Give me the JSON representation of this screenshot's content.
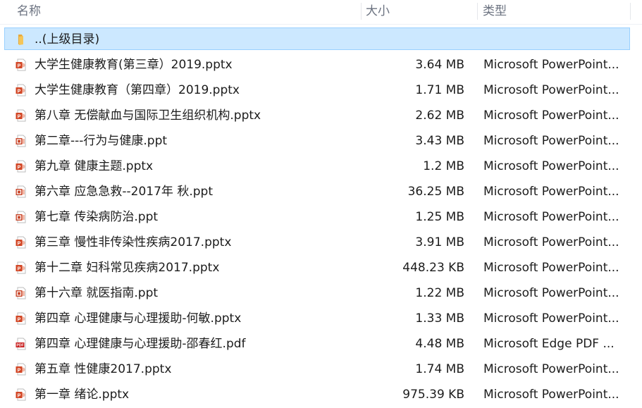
{
  "columns": {
    "name": "名称",
    "size": "大小",
    "type": "类型"
  },
  "colors": {
    "selected_background": "#cce8ff",
    "selected_border": "#99d1ff",
    "ppt_icon": "#d24726",
    "pdf_icon": "#c81e1e",
    "folder_icon": "#f4c55a"
  },
  "parent_row": {
    "name": "..(上级目录)",
    "icon": "folder-icon",
    "selected": true
  },
  "files": [
    {
      "name": "大学生健康教育(第三章）2019.pptx",
      "size": "3.64 MB",
      "type": "Microsoft PowerPoint...",
      "icon": "pptx-file-icon"
    },
    {
      "name": "大学生健康教育（第四章）2019.pptx",
      "size": "1.71 MB",
      "type": "Microsoft PowerPoint...",
      "icon": "pptx-file-icon"
    },
    {
      "name": "第八章  无偿献血与国际卫生组织机构.pptx",
      "size": "2.62 MB",
      "type": "Microsoft PowerPoint...",
      "icon": "pptx-file-icon"
    },
    {
      "name": "第二章---行为与健康.ppt",
      "size": "3.43 MB",
      "type": "Microsoft PowerPoint...",
      "icon": "ppt-file-icon"
    },
    {
      "name": "第九章  健康主题.pptx",
      "size": "1.2 MB",
      "type": "Microsoft PowerPoint...",
      "icon": "pptx-file-icon"
    },
    {
      "name": "第六章 应急急救--2017年 秋.ppt",
      "size": "36.25 MB",
      "type": "Microsoft PowerPoint...",
      "icon": "ppt-file-icon"
    },
    {
      "name": "第七章 传染病防治.ppt",
      "size": "1.25 MB",
      "type": "Microsoft PowerPoint...",
      "icon": "ppt-file-icon"
    },
    {
      "name": "第三章  慢性非传染性疾病2017.pptx",
      "size": "3.91 MB",
      "type": "Microsoft PowerPoint...",
      "icon": "pptx-file-icon"
    },
    {
      "name": "第十二章  妇科常见疾病2017.pptx",
      "size": "448.23 KB",
      "type": "Microsoft PowerPoint...",
      "icon": "pptx-file-icon"
    },
    {
      "name": "第十六章 就医指南.ppt",
      "size": "1.22 MB",
      "type": "Microsoft PowerPoint...",
      "icon": "ppt-file-icon"
    },
    {
      "name": "第四章  心理健康与心理援助-何敏.pptx",
      "size": "1.33 MB",
      "type": "Microsoft PowerPoint...",
      "icon": "pptx-file-icon"
    },
    {
      "name": "第四章 心理健康与心理援助-邵春红.pdf",
      "size": "4.48 MB",
      "type": "Microsoft Edge PDF ...",
      "icon": "pdf-file-icon"
    },
    {
      "name": "第五章 性健康2017.pptx",
      "size": "1.74 MB",
      "type": "Microsoft PowerPoint...",
      "icon": "pptx-file-icon"
    },
    {
      "name": "第一章    绪论.pptx",
      "size": "975.39 KB",
      "type": "Microsoft PowerPoint...",
      "icon": "pptx-file-icon"
    }
  ]
}
